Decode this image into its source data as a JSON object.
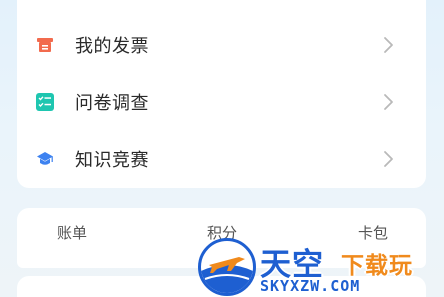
{
  "menu": {
    "items": [
      {
        "label": "我的发票",
        "icon": "invoice-icon",
        "color": "#f26b4e"
      },
      {
        "label": "问卷调查",
        "icon": "checklist-icon",
        "color": "#1ec6b0"
      },
      {
        "label": "知识竞赛",
        "icon": "graduation-cap-icon",
        "color": "#3d82f0"
      }
    ]
  },
  "tabs": {
    "items": [
      {
        "label": "账单"
      },
      {
        "label": "积分"
      },
      {
        "label": "卡包"
      }
    ]
  },
  "watermark": {
    "cn_main": "天空",
    "cn_sub": "下载玩",
    "url": "SKYXZW.COM",
    "brand_color": "#1e5fd1",
    "accent_color": "#f08a1c"
  }
}
